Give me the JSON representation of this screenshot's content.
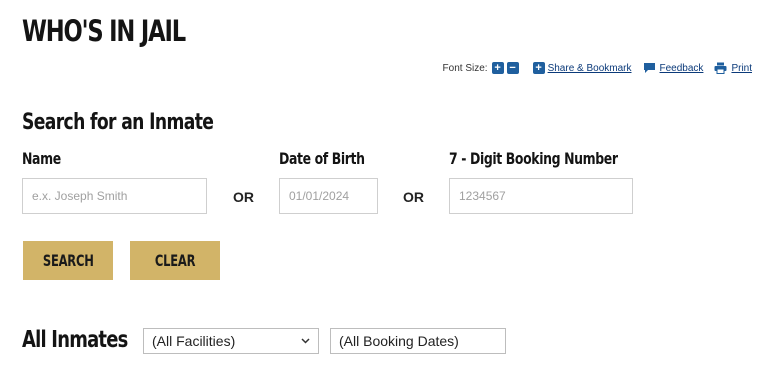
{
  "header": {
    "title": "WHO'S IN JAIL"
  },
  "toolbar": {
    "font_size_label": "Font Size:",
    "increase_glyph": "+",
    "decrease_glyph": "−",
    "share_label": "Share & Bookmark",
    "feedback_label": "Feedback",
    "print_label": "Print",
    "icon_color": "#1f5f9e",
    "link_color": "#0b3a7a"
  },
  "search": {
    "title": "Search for an Inmate",
    "name_label": "Name",
    "name_placeholder": "e.x. Joseph Smith",
    "or_1": "OR",
    "dob_label": "Date of Birth",
    "dob_placeholder": "01/01/2024",
    "or_2": "OR",
    "booking_label": "7 - Digit Booking Number",
    "booking_placeholder": "1234567",
    "search_button": "SEARCH",
    "clear_button": "CLEAR",
    "button_color": "#d2b468"
  },
  "all_inmates": {
    "title": "All Inmates",
    "facility_selected": "(All Facilities)",
    "booking_dates_placeholder": "(All Booking Dates)"
  }
}
